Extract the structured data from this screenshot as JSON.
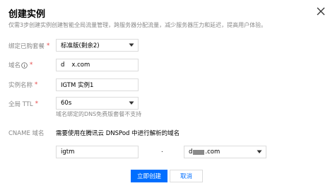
{
  "dialog": {
    "title": "创建实例",
    "subtitle": "仅需3步创建实例创建智能全局流量管理，跨服务器分配流量，减少服务器压力和延迟，提高用户体验。"
  },
  "form": {
    "package": {
      "label": "绑定已购套餐",
      "value": "标准版(剩余2)"
    },
    "domain": {
      "label": "域名",
      "value_prefix": "d",
      "value_suffix": "x.com"
    },
    "instance_name": {
      "label": "实例名称",
      "value": "IGTM 实例1"
    },
    "ttl": {
      "label": "全局 TTL",
      "value": "60s",
      "hint": "域名绑定的DNS免费版套餐不支持"
    },
    "cname": {
      "label": "CNAME 域名",
      "instruction": "需要使用在腾讯云 DNSPod 中进行解析的域名",
      "prefix": "igtm",
      "separator": ".",
      "domain_prefix": "d",
      "domain_suffix": ".com"
    }
  },
  "footer": {
    "confirm_label": "立即创建",
    "cancel_label": "取消"
  },
  "colors": {
    "primary": "#006eff",
    "required": "#e54545"
  },
  "icons": {
    "close": "close-icon",
    "info": "info-icon",
    "dropdown": "chevron-down-icon"
  }
}
